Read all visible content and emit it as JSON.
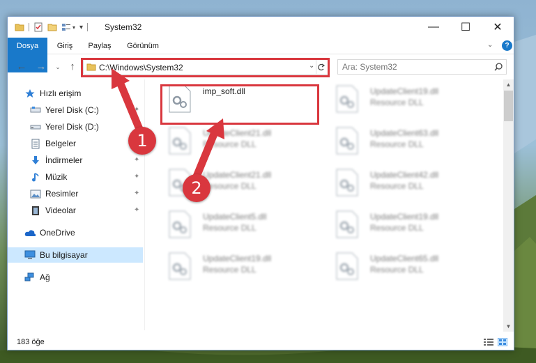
{
  "window": {
    "title": "System32",
    "controls": {
      "minimize": "—",
      "maximize": "☐",
      "close": "✕"
    }
  },
  "ribbon": {
    "tabs": [
      {
        "label": "Dosya"
      },
      {
        "label": "Giriş"
      },
      {
        "label": "Paylaş"
      },
      {
        "label": "Görünüm"
      }
    ],
    "help": "?"
  },
  "navigation": {
    "address": "C:\\Windows\\System32",
    "search_placeholder": "Ara: System32"
  },
  "sidebar": {
    "items": [
      {
        "label": "Hızlı erişim",
        "icon": "star-icon",
        "pinned": false
      },
      {
        "label": "Yerel Disk (C:)",
        "icon": "drive-icon",
        "pinned": true
      },
      {
        "label": "Yerel Disk (D:)",
        "icon": "drive-icon",
        "pinned": true
      },
      {
        "label": "Belgeler",
        "icon": "document-icon",
        "pinned": true
      },
      {
        "label": "İndirmeler",
        "icon": "download-icon",
        "pinned": true
      },
      {
        "label": "Müzik",
        "icon": "music-icon",
        "pinned": true
      },
      {
        "label": "Resimler",
        "icon": "picture-icon",
        "pinned": true
      },
      {
        "label": "Videolar",
        "icon": "video-icon",
        "pinned": true
      },
      {
        "label": "OneDrive",
        "icon": "cloud-icon",
        "pinned": false
      },
      {
        "label": "Bu bilgisayar",
        "icon": "computer-icon",
        "pinned": false,
        "selected": true
      },
      {
        "label": "Ağ",
        "icon": "network-icon",
        "pinned": false
      }
    ]
  },
  "files": [
    {
      "name": "imp_soft.dll",
      "type": "",
      "blurred": false
    },
    {
      "name": "UpdateClient19.dll",
      "type": "Resource DLL",
      "blurred": true
    },
    {
      "name": "UpdateClient21.dll",
      "type": "Resource DLL",
      "blurred": true
    },
    {
      "name": "UpdateClient63.dll",
      "type": "Resource DLL",
      "blurred": true
    },
    {
      "name": "UpdateClient21.dll",
      "type": "Resource DLL",
      "blurred": true
    },
    {
      "name": "UpdateClient42.dll",
      "type": "Resource DLL",
      "blurred": true
    },
    {
      "name": "UpdateClient5.dll",
      "type": "Resource DLL",
      "blurred": true
    },
    {
      "name": "UpdateClient19.dll",
      "type": "Resource DLL",
      "blurred": true
    },
    {
      "name": "UpdateClient19.dll",
      "type": "Resource DLL",
      "blurred": true
    },
    {
      "name": "UpdateClient65.dll",
      "type": "Resource DLL",
      "blurred": true
    }
  ],
  "status": {
    "count": "183 öğe"
  },
  "annotations": {
    "step1": "1",
    "step2": "2",
    "color": "#d9373e"
  },
  "colors": {
    "accent": "#1979ca",
    "selection": "#cce8ff"
  }
}
